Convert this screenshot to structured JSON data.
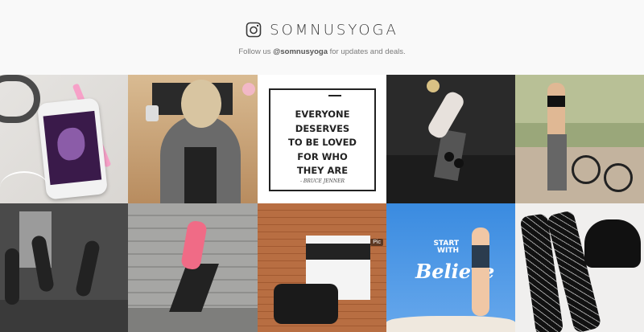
{
  "header": {
    "brand": "SOMNUSYOGA",
    "tagline_prefix": "Follow us ",
    "tagline_handle": "@somnusyoga",
    "tagline_suffix": " for updates and deals.",
    "icon": "instagram-icon"
  },
  "grid": {
    "quote": {
      "lines": [
        "EVERYONE",
        "DESERVES",
        "TO BE LOVED",
        "FOR WHO",
        "THEY ARE"
      ],
      "author": "- BRUCE JENNER"
    },
    "believe": {
      "start": "START",
      "with": "WITH",
      "word": "Believe"
    },
    "pic_badge": "Pic"
  }
}
